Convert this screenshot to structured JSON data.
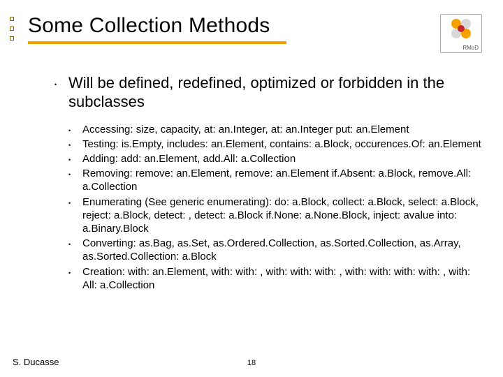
{
  "logo": {
    "label": "RMoD"
  },
  "title": "Some Collection Methods",
  "main_bullet": "Will be defined, redefined, optimized or forbidden in the subclasses",
  "sub_bullets": [
    "Accessing: size,  capacity,  at: an.Integer,  at: an.Integer put: an.Element",
    "Testing:  is.Empty,  includes: an.Element,  contains: a.Block, occurences.Of: an.Element",
    "Adding:  add: an.Element,  add.All: a.Collection",
    "Removing:  remove: an.Element,  remove: an.Element if.Absent: a.Block,  remove.All: a.Collection",
    "Enumerating (See generic enumerating):  do: a.Block,  collect: a.Block, select: a.Block,  reject: a.Block,  detect: ,  detect: a.Block if.None: a.None.Block,  inject: avalue into: a.Binary.Block",
    "Converting:  as.Bag,  as.Set,  as.Ordered.Collection, as.Sorted.Collection,  as.Array,  as.Sorted.Collection: a.Block",
    "Creation:  with: an.Element,  with: with: ,  with: with: with: , with: with: with: with: ,  with: All: a.Collection"
  ],
  "footer": {
    "author": "S. Ducasse",
    "page": "18"
  }
}
